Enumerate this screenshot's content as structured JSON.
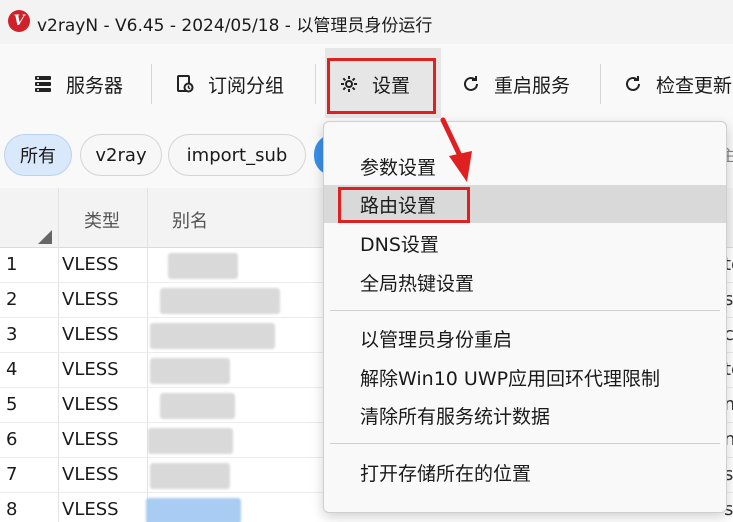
{
  "window": {
    "title": "v2rayN - V6.45 - 2024/05/18 - 以管理员身份运行",
    "logo_letter": "V"
  },
  "toolbar": {
    "servers": {
      "label": "服务器",
      "icon": "server-icon"
    },
    "subscription": {
      "label": "订阅分组",
      "icon": "subscription-icon"
    },
    "settings": {
      "label": "设置",
      "icon": "gear-icon"
    },
    "restart": {
      "label": "重启服务",
      "icon": "refresh-icon"
    },
    "check_update": {
      "label": "检查更新",
      "icon": "refresh-icon"
    }
  },
  "filters": {
    "all": "所有",
    "v2ray": "v2ray",
    "import_sub": "import_sub",
    "partial_right": "主"
  },
  "table": {
    "headers": {
      "type": "类型",
      "alias": "别名"
    },
    "rows": [
      {
        "index": "1",
        "type": "VLESS",
        "right": "te"
      },
      {
        "index": "2",
        "type": "VLESS",
        "right": "si"
      },
      {
        "index": "3",
        "type": "VLESS",
        "right": "c"
      },
      {
        "index": "4",
        "type": "VLESS",
        "right": "te"
      },
      {
        "index": "5",
        "type": "VLESS",
        "right": "m"
      },
      {
        "index": "6",
        "type": "VLESS",
        "right": "n"
      },
      {
        "index": "7",
        "type": "VLESS",
        "right": "si"
      },
      {
        "index": "8",
        "type": "VLESS",
        "right": "si"
      }
    ]
  },
  "settings_menu": {
    "items": [
      {
        "label": "参数设置"
      },
      {
        "label": "路由设置",
        "highlighted": true
      },
      {
        "label": "DNS设置"
      },
      {
        "label": "全局热键设置"
      },
      {
        "label": "以管理员身份重启"
      },
      {
        "label": "解除Win10 UWP应用回环代理限制"
      },
      {
        "label": "清除所有服务统计数据"
      },
      {
        "label": "打开存储所在的位置"
      }
    ]
  },
  "colors": {
    "highlight_box": "#e02020",
    "active_chip": "#d9e9fb",
    "logo": "#d0202a"
  }
}
